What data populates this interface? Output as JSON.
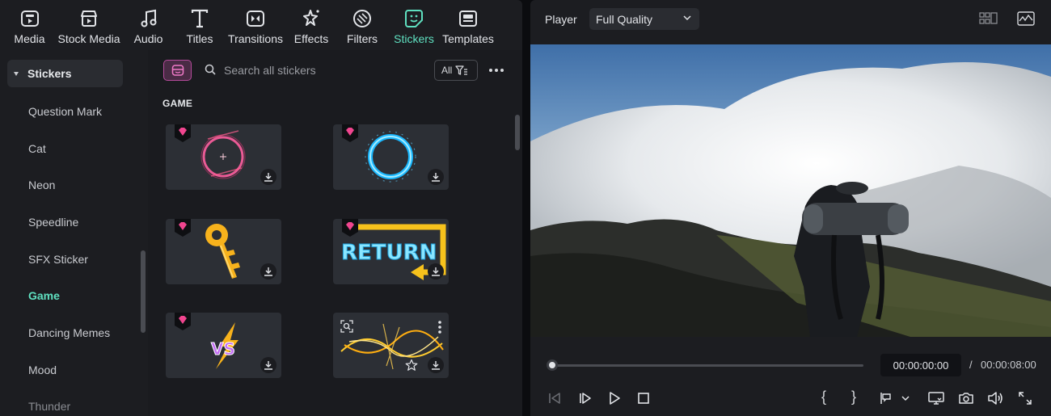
{
  "toolbar": {
    "items": [
      {
        "label": "Media",
        "icon": "media-icon"
      },
      {
        "label": "Stock Media",
        "icon": "stock-media-icon"
      },
      {
        "label": "Audio",
        "icon": "music-note-icon"
      },
      {
        "label": "Titles",
        "icon": "text-t-icon"
      },
      {
        "label": "Transitions",
        "icon": "transitions-icon"
      },
      {
        "label": "Effects",
        "icon": "sparkle-icon"
      },
      {
        "label": "Filters",
        "icon": "filters-icon"
      },
      {
        "label": "Stickers",
        "icon": "sticker-icon"
      },
      {
        "label": "Templates",
        "icon": "templates-icon"
      }
    ],
    "active": "Stickers"
  },
  "sidebar": {
    "header": "Stickers",
    "items": [
      "Question Mark",
      "Cat",
      "Neon",
      "Speedline",
      "SFX Sticker",
      "Game",
      "Dancing Memes",
      "Mood",
      "Thunder"
    ],
    "active": "Game"
  },
  "search": {
    "placeholder": "Search all stickers",
    "filter_label": "All"
  },
  "section": {
    "title": "GAME"
  },
  "stickers": [
    {
      "name": "neon-pink-target-ring",
      "premium": true
    },
    {
      "name": "neon-blue-ring",
      "premium": true
    },
    {
      "name": "golden-key",
      "premium": true
    },
    {
      "name": "return-arrow-sign",
      "premium": true,
      "text": "RETURN"
    },
    {
      "name": "vs-lightning",
      "premium": true,
      "text": "VS"
    },
    {
      "name": "golden-light-streaks",
      "premium": false
    }
  ],
  "player": {
    "label": "Player",
    "quality": "Full Quality",
    "time_current": "00:00:00:00",
    "time_separator": "/",
    "time_total": "00:00:08:00",
    "progress": 0,
    "bracket_in": "{",
    "bracket_out": "}"
  },
  "colors": {
    "accent": "#5fe0c0",
    "panel": "#1c1d21",
    "premium": "#e8408f"
  }
}
